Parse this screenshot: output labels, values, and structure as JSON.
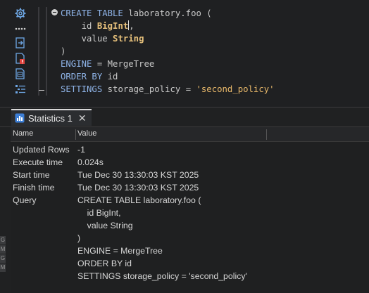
{
  "editor": {
    "lines": [
      [
        {
          "t": "CREATE TABLE ",
          "c": "kw"
        },
        {
          "t": "laboratory.foo (",
          "c": "id"
        }
      ],
      [
        {
          "t": "    id ",
          "c": "id"
        },
        {
          "t": "BigInt",
          "c": "ty"
        },
        {
          "t": "|",
          "c": "caret"
        },
        {
          "t": ",",
          "c": "id"
        }
      ],
      [
        {
          "t": "    value ",
          "c": "id"
        },
        {
          "t": "String",
          "c": "ty"
        }
      ],
      [
        {
          "t": ")",
          "c": "id"
        }
      ],
      [
        {
          "t": "ENGINE",
          "c": "kw"
        },
        {
          "t": " = MergeTree",
          "c": "id"
        }
      ],
      [
        {
          "t": "ORDER BY ",
          "c": "kw"
        },
        {
          "t": "id",
          "c": "id"
        }
      ],
      [
        {
          "t": "SETTINGS ",
          "c": "kw"
        },
        {
          "t": "storage_policy = ",
          "c": "id"
        },
        {
          "t": "'second_policy'",
          "c": "str"
        }
      ]
    ]
  },
  "tools": [
    "gear-icon",
    "more-icon",
    "export-icon",
    "error-file-icon",
    "script-file-icon",
    "outline-icon"
  ],
  "results": {
    "tab_label": "Statistics 1",
    "close_glyph": "✕",
    "columns": [
      "Name",
      "Value"
    ],
    "rows": [
      {
        "name": "Updated Rows",
        "value": "-1"
      },
      {
        "name": "Execute time",
        "value": "0.024s"
      },
      {
        "name": "Start time",
        "value": "Tue Dec 30 13:30:03 KST 2025"
      },
      {
        "name": "Finish time",
        "value": "Tue Dec 30 13:30:03 KST 2025"
      },
      {
        "name": "Query",
        "value": "CREATE TABLE laboratory.foo ("
      },
      {
        "name": "",
        "value": "    id BigInt,"
      },
      {
        "name": "",
        "value": "    value String"
      },
      {
        "name": "",
        "value": ")"
      },
      {
        "name": "",
        "value": "ENGINE = MergeTree"
      },
      {
        "name": "",
        "value": "ORDER BY id"
      },
      {
        "name": "",
        "value": "SETTINGS storage_policy = 'second_policy'"
      }
    ]
  },
  "left_marks": [
    "G",
    "M",
    "G",
    "M"
  ]
}
